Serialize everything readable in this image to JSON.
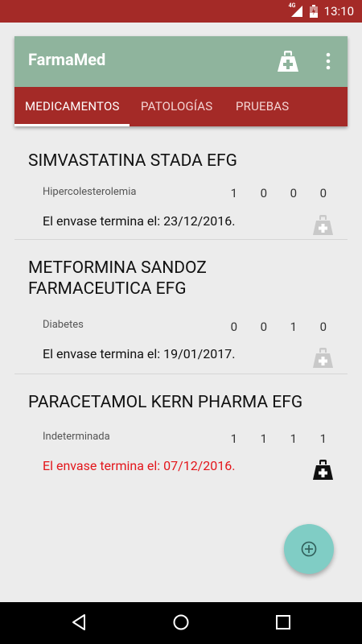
{
  "status_bar": {
    "time": "13:10",
    "network": "4G"
  },
  "toolbar": {
    "title": "FarmaMed",
    "add_icon": "medical-kit-icon",
    "more_icon": "more-vert-icon"
  },
  "tabs": [
    {
      "label": "MEDICAMENTOS",
      "active": true
    },
    {
      "label": "PATOLOGÍAS",
      "active": false
    },
    {
      "label": "PRUEBAS",
      "active": false
    }
  ],
  "medications": [
    {
      "name": "SIMVASTATINA STADA EFG",
      "pathology": "Hipercolesterolemia",
      "counts": [
        "1",
        "0",
        "0",
        "0"
      ],
      "expiry": "El envase termina el: 23/12/2016.",
      "expiry_color": "#111111",
      "kit_color": "#c9c9c9"
    },
    {
      "name": "METFORMINA SANDOZ FARMACEUTICA EFG",
      "pathology": "Diabetes",
      "counts": [
        "0",
        "0",
        "1",
        "0"
      ],
      "expiry": "El envase termina el: 19/01/2017.",
      "expiry_color": "#111111",
      "kit_color": "#c9c9c9"
    },
    {
      "name": "PARACETAMOL KERN PHARMA EFG",
      "pathology": "Indeterminada",
      "counts": [
        "1",
        "1",
        "1",
        "1"
      ],
      "expiry": "El envase termina el: 07/12/2016.",
      "expiry_color": "#e3161b",
      "kit_color": "#111111"
    }
  ],
  "fab": {
    "icon": "add-circle-icon"
  },
  "nav": {
    "back_icon": "back-icon",
    "home_icon": "home-icon",
    "recents_icon": "recents-icon"
  },
  "colors": {
    "toolbar": "#8fb49d",
    "tabs": "#a42a27",
    "fab": "#80cdc5",
    "alert": "#e3161b"
  }
}
